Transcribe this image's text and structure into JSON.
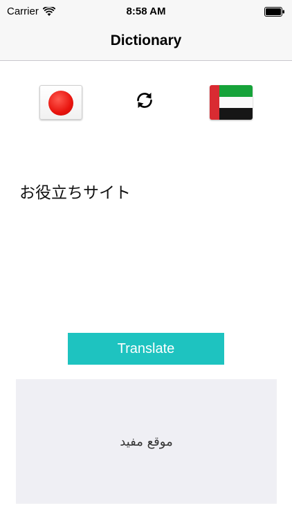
{
  "status_bar": {
    "carrier": "Carrier",
    "time": "8:58 AM",
    "icons": [
      "wifi-icon",
      "battery-icon"
    ]
  },
  "nav": {
    "title": "Dictionary"
  },
  "languages": {
    "source_flag": "japan-flag-icon",
    "target_flag": "uae-flag-icon",
    "swap_icon": "swap-arrows-icon"
  },
  "input": {
    "text": "お役立ちサイト"
  },
  "actions": {
    "translate_label": "Translate"
  },
  "output": {
    "text": "موقع مفيد"
  },
  "colors": {
    "accent": "#1ec3c0",
    "result_background": "#efeff4",
    "bar_background": "#f7f7f7"
  }
}
